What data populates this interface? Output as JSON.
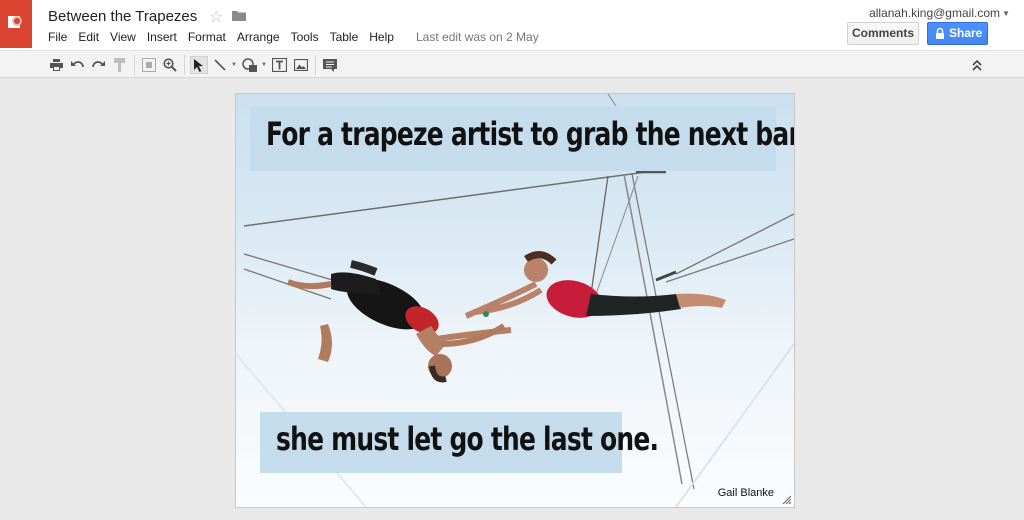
{
  "doc": {
    "title": "Between the Trapezes",
    "last_edit": "Last edit was on 2 May"
  },
  "menu": [
    "File",
    "Edit",
    "View",
    "Insert",
    "Format",
    "Arrange",
    "Tools",
    "Table",
    "Help"
  ],
  "account": {
    "email": "allanah.king@gmail.com"
  },
  "buttons": {
    "comments": "Comments",
    "share": "Share"
  },
  "toolbar_icons": [
    "print-icon",
    "undo-icon",
    "redo-icon",
    "paint-format-icon",
    "fit-icon",
    "zoom-icon",
    "select-icon",
    "line-icon",
    "shape-icon",
    "text-box-icon",
    "image-icon",
    "comment-icon",
    "collapse-icon"
  ],
  "slide": {
    "quote_top": "For a trapeze artist to grab the next bar",
    "quote_bottom": "she must let go the last one.",
    "credit": "Gail Blanke"
  },
  "colors": {
    "brand": "#d9432f",
    "share": "#4d90fe",
    "quote_box": "#c5dcec"
  }
}
